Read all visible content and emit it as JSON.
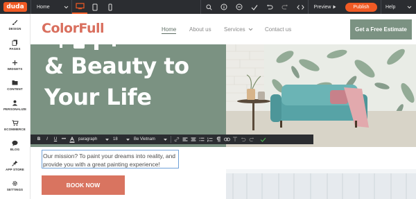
{
  "topbar": {
    "logo": "duda",
    "page_select": "Home",
    "preview_label": "Preview",
    "publish_label": "Publish",
    "help_label": "Help"
  },
  "sidebar": {
    "items": [
      {
        "label": "DESIGN",
        "icon": "brush-icon"
      },
      {
        "label": "PAGES",
        "icon": "pages-icon"
      },
      {
        "label": "WIDGETS",
        "icon": "plus-icon"
      },
      {
        "label": "CONTENT",
        "icon": "folder-icon"
      },
      {
        "label": "PERSONALIZE",
        "icon": "person-icon"
      },
      {
        "label": "ECOMMERCE",
        "icon": "cart-icon"
      },
      {
        "label": "BLOG",
        "icon": "chat-icon"
      },
      {
        "label": "APP STORE",
        "icon": "pin-icon"
      },
      {
        "label": "SETTINGS",
        "icon": "gear-icon"
      }
    ]
  },
  "site": {
    "brand": "ColorFull",
    "nav": {
      "home": "Home",
      "about": "About us",
      "services": "Services",
      "contact": "Contact us"
    },
    "cta": "Get a Free Estimate",
    "hero_line1": "& Beauty to",
    "hero_line2": "Your Life",
    "mission": "Our mission? To paint your dreams into reality, and provide you with a great painting experience!",
    "book_button": "BOOK NOW"
  },
  "text_toolbar": {
    "style": "paragraph",
    "size": "18",
    "font": "Be Vietnam"
  },
  "colors": {
    "accent": "#f15a24",
    "brand": "#d96f5e",
    "sage": "#7b9282",
    "button": "#d97460",
    "dark": "#2b2d31"
  }
}
